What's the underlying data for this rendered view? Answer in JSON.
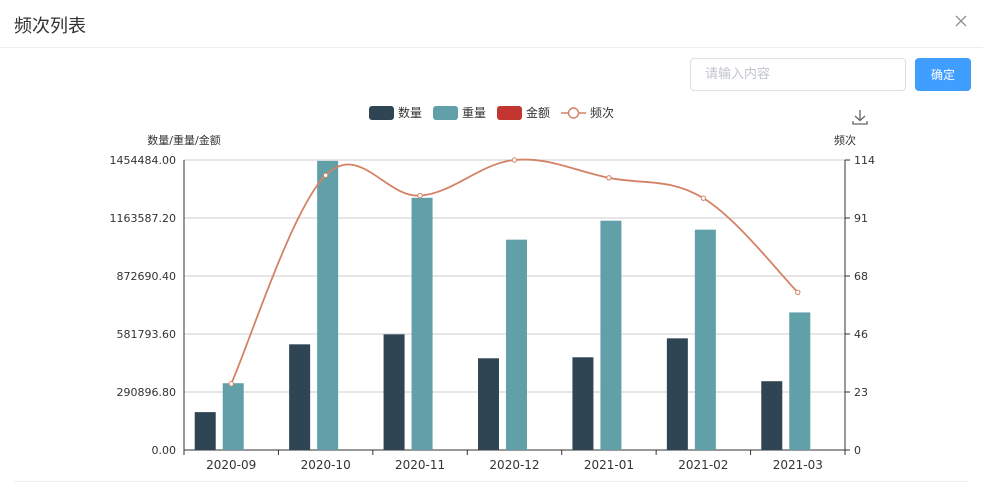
{
  "dialog": {
    "title": "频次列表"
  },
  "search": {
    "placeholder": "请输入内容",
    "value": ""
  },
  "buttons": {
    "confirm_label": "确定"
  },
  "icons": {
    "close": "close-icon",
    "download": "download-icon"
  },
  "chart_data": {
    "type": "bar",
    "categories": [
      "2020-09",
      "2020-10",
      "2020-11",
      "2020-12",
      "2021-01",
      "2021-02",
      "2021-03"
    ],
    "series": [
      {
        "name": "数量",
        "type": "bar",
        "color": "#2f4554",
        "axis": "left",
        "values": [
          190000,
          530000,
          580000,
          460000,
          465000,
          560000,
          345000
        ]
      },
      {
        "name": "重量",
        "type": "bar",
        "color": "#61a0a8",
        "axis": "left",
        "values": [
          335000,
          1450000,
          1265000,
          1055000,
          1150000,
          1105000,
          690000
        ]
      },
      {
        "name": "金额",
        "type": "bar",
        "color": "#c23531",
        "axis": "left",
        "values": [
          0,
          0,
          0,
          0,
          0,
          0,
          0
        ]
      },
      {
        "name": "频次",
        "type": "line",
        "color": "#d48265",
        "axis": "right",
        "values": [
          26,
          108,
          100,
          114,
          107,
          99,
          62
        ]
      }
    ],
    "left_axis": {
      "label": "数量/重量/金额",
      "min": 0,
      "max": 1454484,
      "ticks": [
        "0.00",
        "290896.80",
        "581793.60",
        "872690.40",
        "1163587.20",
        "1454484.00"
      ]
    },
    "right_axis": {
      "label": "频次",
      "min": 0,
      "max": 114,
      "ticks": [
        "0",
        "23",
        "46",
        "68",
        "91",
        "114"
      ]
    },
    "grid": true,
    "legend": "top-center"
  }
}
